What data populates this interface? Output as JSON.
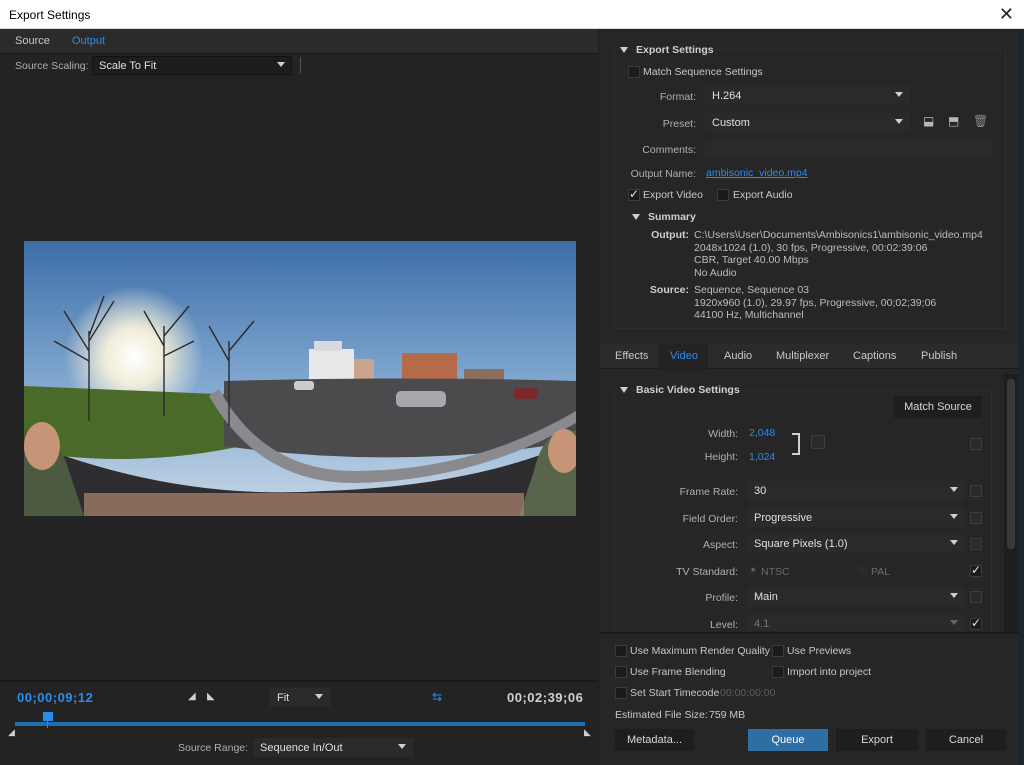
{
  "window": {
    "title": "Export Settings",
    "close_glyph": "✕"
  },
  "left": {
    "tabs": [
      "Source",
      "Output"
    ],
    "source_scaling_label": "Source Scaling:",
    "source_scaling_value": "Scale To Fit",
    "timecode_current": "00;00;09;12",
    "timecode_end": "00;02;39;06",
    "zoom_value": "Fit",
    "source_range_label": "Source Range:",
    "source_range_value": "Sequence In/Out"
  },
  "export_settings": {
    "section_title": "Export Settings",
    "match_sequence": "Match Sequence Settings",
    "format_label": "Format:",
    "format_value": "H.264",
    "preset_label": "Preset:",
    "preset_value": "Custom",
    "comments_label": "Comments:",
    "output_name_label": "Output Name:",
    "output_name_value": "ambisonic_video.mp4",
    "export_video": "Export Video",
    "export_audio": "Export Audio"
  },
  "summary": {
    "title": "Summary",
    "output_label": "Output:",
    "output_lines": [
      "C:\\Users\\User\\Documents\\Ambisonics1\\ambisonic_video.mp4",
      "2048x1024 (1.0), 30 fps, Progressive, 00:02:39:06",
      "CBR, Target 40.00 Mbps",
      "No Audio"
    ],
    "source_label": "Source:",
    "source_lines": [
      "Sequence, Sequence 03",
      "1920x960 (1.0), 29.97 fps, Progressive, 00;02;39;06",
      "44100 Hz, Multichannel"
    ]
  },
  "right_tabs": [
    "Effects",
    "Video",
    "Audio",
    "Multiplexer",
    "Captions",
    "Publish"
  ],
  "video": {
    "section_title": "Basic Video Settings",
    "match_source": "Match Source",
    "width_label": "Width:",
    "width_value": "2,048",
    "height_label": "Height:",
    "height_value": "1,024",
    "frame_rate_label": "Frame Rate:",
    "frame_rate_value": "30",
    "field_order_label": "Field Order:",
    "field_order_value": "Progressive",
    "aspect_label": "Aspect:",
    "aspect_value": "Square Pixels (1.0)",
    "tv_standard_label": "TV Standard:",
    "ntsc": "NTSC",
    "pal": "PAL",
    "profile_label": "Profile:",
    "profile_value": "Main",
    "level_label": "Level:",
    "level_value": "4.1"
  },
  "bottom": {
    "max_render": "Use Maximum Render Quality",
    "use_previews": "Use Previews",
    "frame_blending": "Use Frame Blending",
    "import_project": "Import into project",
    "start_timecode": "Set Start Timecode",
    "start_timecode_value": "00:00:00:00",
    "file_size_label": "Estimated File Size:",
    "file_size_value": "759 MB",
    "metadata": "Metadata...",
    "queue": "Queue",
    "export": "Export",
    "cancel": "Cancel"
  },
  "colors": {
    "accent": "#2d8ceb",
    "panel": "#232323",
    "timebar": "#1f6fb0"
  }
}
